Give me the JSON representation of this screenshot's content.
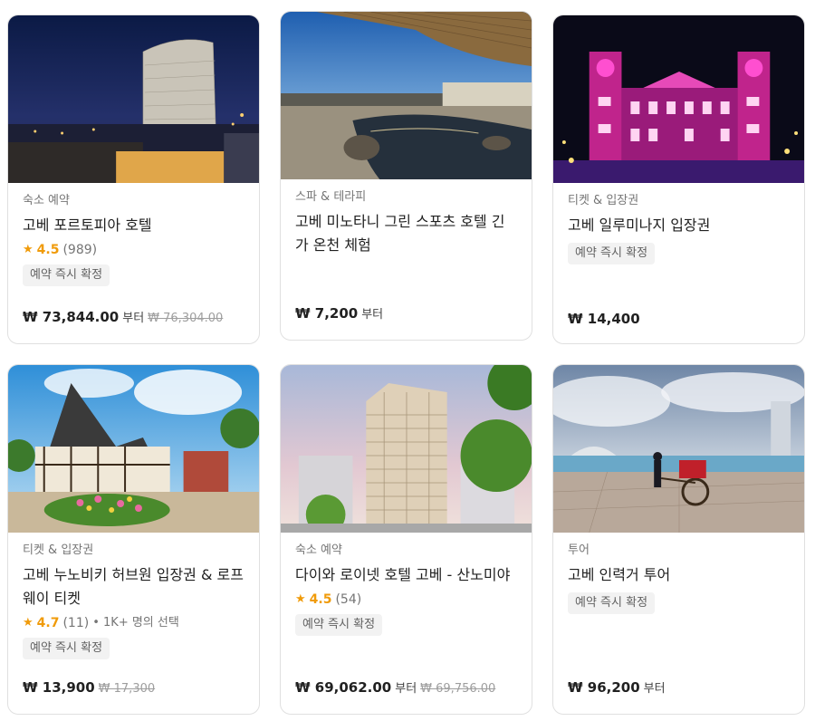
{
  "cards": [
    {
      "category": "숙소 예약",
      "title": "고베 포르토피아 호텔",
      "rating": "4.5",
      "reviews": "(989)",
      "extra": "",
      "badge": "예약 즉시 확정",
      "price": "₩ 73,844.00",
      "from": "부터",
      "original": "₩ 76,304.00"
    },
    {
      "category": "스파 & 테라피",
      "title": "고베 미노타니 그린 스포츠 호텔 긴가 온천 체험",
      "price": "₩ 7,200",
      "from": "부터"
    },
    {
      "category": "티켓 & 입장권",
      "title": "고베 일루미나지 입장권",
      "badge": "예약 즉시 확정",
      "price": "₩ 14,400"
    },
    {
      "category": "티켓 & 입장권",
      "title": "고베 누노비키 허브원 입장권 & 로프웨이 티켓",
      "rating": "4.7",
      "reviews": "(11)",
      "extra": "• 1K+ 명의 선택",
      "badge": "예약 즉시 확정",
      "price": "₩ 13,900",
      "original": "₩ 17,300"
    },
    {
      "category": "숙소 예약",
      "title": "다이와 로이넷 호텔 고베 - 산노미야",
      "rating": "4.5",
      "reviews": "(54)",
      "badge": "예약 즉시 확정",
      "price": "₩ 69,062.00",
      "from": "부터",
      "original": "₩ 69,756.00"
    },
    {
      "category": "투어",
      "title": "고베 인력거 투어",
      "badge": "예약 즉시 확정",
      "price": "₩ 96,200",
      "from": "부터"
    }
  ],
  "icons": {
    "rating": "star-icon"
  },
  "colors": {
    "star": "#f09b0a",
    "badge_bg": "#f2f2f2",
    "strike": "#9e9e9e"
  }
}
